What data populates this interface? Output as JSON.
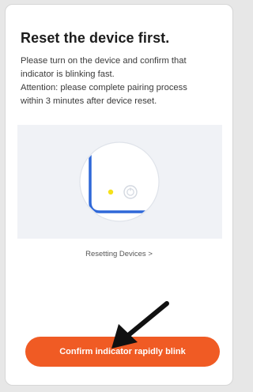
{
  "header": {
    "title": "Reset the device first."
  },
  "instructions": {
    "line1": "Please turn on the device and confirm that",
    "line2": "indicator is blinking fast.",
    "line3": "Attention: please complete pairing process",
    "line4": "within 3 minutes after device reset."
  },
  "help_link": {
    "label": "Resetting Devices >"
  },
  "confirm_button": {
    "label": "Confirm indicator rapidly blink"
  },
  "colors": {
    "accent": "#f05b24",
    "indicator_led": "#f5e11a",
    "illustration_bg": "#f0f2f6"
  },
  "icons": {
    "device_button": "power-button-icon",
    "annotation": "arrow-pointer-icon"
  }
}
